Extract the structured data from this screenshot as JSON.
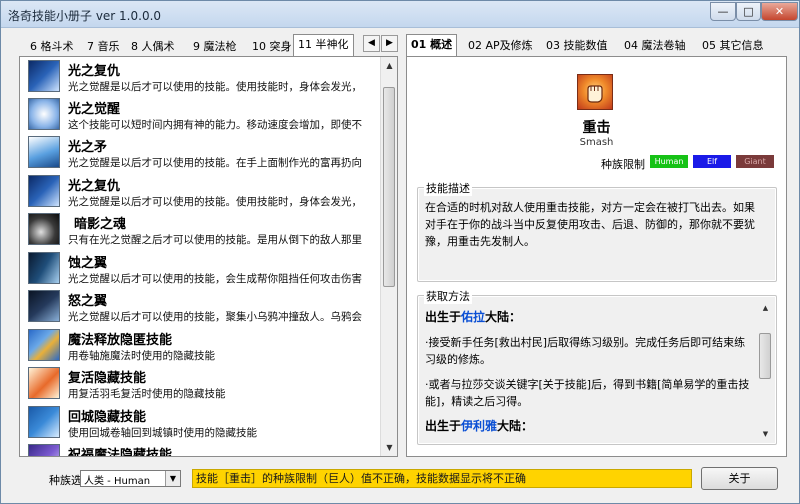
{
  "window": {
    "title": "洛奇技能小册子 ver 1.0.0.0",
    "min_label": "—",
    "max_label": "□",
    "close_label": "✕"
  },
  "left_tabs": [
    "6 格斗术",
    "7 音乐",
    "8 人偶术",
    "9 魔法枪",
    "10 突身",
    "11 半神化"
  ],
  "left_tabs_nav": {
    "prev": "◀",
    "next": "▶"
  },
  "skills": [
    {
      "name": "光之复仇",
      "desc": "光之觉醒是以后才可以使用的技能。使用技能时，身体会发光，",
      "icon": "light-revenge-icon",
      "color": "#2a63b8"
    },
    {
      "name": "光之觉醒",
      "desc": "这个技能可以短时间内拥有神的能力。移动速度会增加，即使不",
      "icon": "light-awakening-icon",
      "color": "#8ab4e8"
    },
    {
      "name": "光之矛",
      "desc": "光之觉醒是以后才可以使用的技能。在手上面制作光的富再扔向",
      "icon": "light-spear-icon",
      "color": "#5aa0e0"
    },
    {
      "name": "光之复仇",
      "desc": "光之觉醒是以后才可以使用的技能。使用技能时，身体会发光，",
      "icon": "light-revenge-icon",
      "color": "#2a63b8"
    },
    {
      "name": "暗影之魂",
      "desc": "只有在光之觉醒之后才可以使用的技能。是用从倒下的敌人那里",
      "icon": "shadow-soul-icon",
      "color": "#3a3a3a"
    },
    {
      "name": "蚀之翼",
      "desc": "光之觉醒以后才可以使用的技能，会生成帮你阻挡任何攻击伤害",
      "icon": "eclipse-wing-icon",
      "color": "#1f4e7a"
    },
    {
      "name": "怒之翼",
      "desc": "光之觉醒以后才可以使用的技能，聚集小乌鸦冲撞敌人。乌鸦会",
      "icon": "wrath-wing-icon",
      "color": "#253a5c"
    },
    {
      "name": "魔法释放隐匿技能",
      "desc": "用卷轴施魔法时使用的隐藏技能",
      "icon": "magic-scroll-icon",
      "color": "#e8b03a"
    },
    {
      "name": "复活隐藏技能",
      "desc": "用复活羽毛复活时使用的隐藏技能",
      "icon": "feather-icon",
      "color": "#e86a2a"
    },
    {
      "name": "回城隐藏技能",
      "desc": "使用回城卷轴回到城镇时使用的隐藏技能",
      "icon": "return-scroll-icon",
      "color": "#3a8ad8"
    },
    {
      "name": "祝福魔法隐藏技能",
      "desc": "",
      "icon": "blessing-icon",
      "color": "#7a5ad0"
    }
  ],
  "right_tabs": [
    "01 概述",
    "02 AP及修炼",
    "03 技能数值",
    "04 魔法卷轴",
    "05 其它信息"
  ],
  "detail": {
    "name": "重击",
    "name_en": "Smash",
    "race_label": "种族限制",
    "races": [
      {
        "label": "Human",
        "bg": "#16c216",
        "fg": "#ffffff"
      },
      {
        "label": "Elf",
        "bg": "#1a1ae8",
        "fg": "#ffffff"
      },
      {
        "label": "Giant",
        "bg": "#7a3a3a",
        "fg": "#d8a8a8"
      }
    ],
    "desc_legend": "技能描述",
    "desc_text": "在合适的时机对敌人使用重击技能，对方一定会在被打飞出去。如果对手在于你的战斗当中反复使用攻击、后退、防御的，那你就不要犹豫，用重击先发制人。",
    "src_legend": "获取方法",
    "src_h1_prefix": "出生于",
    "src_h1_place": "佑拉",
    "src_h1_suffix": "大陆：",
    "src_p1": "·接受新手任务[救出村民]后取得练习级别。完成任务后即可结束练习级的修炼。",
    "src_p2": "·或者与拉莎交谈关键字[关于技能]后，得到书籍[简单易学的重击技能]，精读之后习得。",
    "src_h2_prefix": "出生于",
    "src_h2_place": "伊利雅",
    "src_h2_suffix": "大陆："
  },
  "bottom": {
    "race_select_label": "种族选择:",
    "race_select_value": "人类 - Human",
    "status": "技能［重击］的种族限制（巨人）值不正确，技能数据显示将不正确",
    "about": "关于"
  }
}
